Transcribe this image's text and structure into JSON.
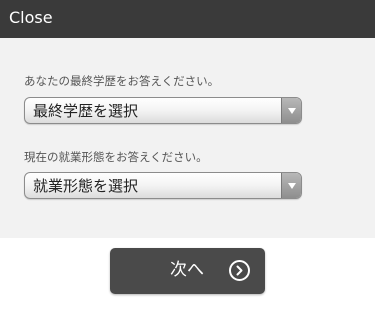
{
  "header": {
    "close_label": "Close"
  },
  "questions": [
    {
      "prompt": "あなたの最終学歴をお答えください。",
      "select_value": "最終学歴を選択"
    },
    {
      "prompt": "現在の就業形態をお答えください。",
      "select_value": "就業形態を選択"
    }
  ],
  "next_button": {
    "label": "次へ",
    "icon": "chevron-right-circle-icon"
  },
  "colors": {
    "header_bg": "#3a3a3a",
    "panel_bg": "#f2f2f2",
    "button_bg": "#4a4a4a"
  }
}
